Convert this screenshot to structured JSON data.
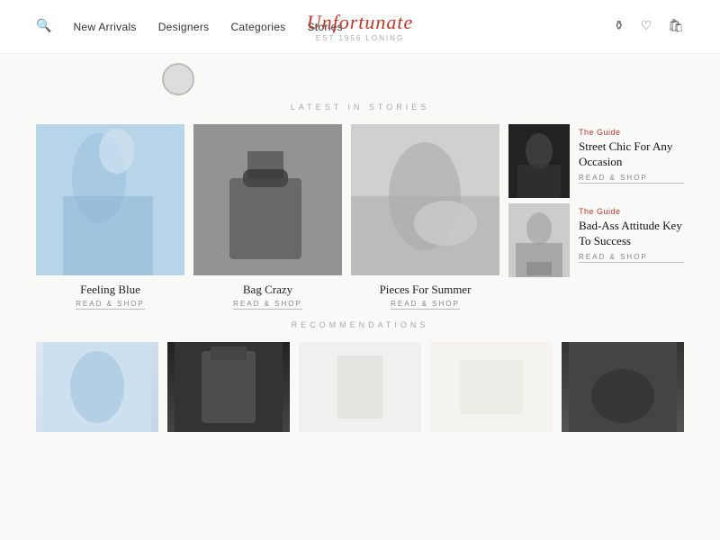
{
  "nav": {
    "links": [
      "New Arrivals",
      "Designers",
      "Categories",
      "Stories"
    ],
    "brand": "Unfortunate",
    "brand_sub": "EST 1956 LONING",
    "search_label": "🔍",
    "wishlist_label": "♡",
    "cart_label": "🛍"
  },
  "stories_section": {
    "label": "LATEST IN STORIES",
    "stories": [
      {
        "title": "Feeling Blue",
        "link": "READ & SHOP",
        "img_class": "story-img-blue"
      },
      {
        "title": "Bag Crazy",
        "link": "READ & SHOP",
        "img_class": "story-img-bw1"
      },
      {
        "title": "Pieces For Summer",
        "link": "READ & SHOP",
        "img_class": "story-img-bw2"
      }
    ],
    "side_articles": [
      {
        "guide": "The Guide",
        "title": "Street Chic For Any Occasion",
        "link": "READ & SHOP",
        "img_class": "side-article-img-1"
      },
      {
        "guide": "The Guide",
        "title": "Bad-Ass Attitude Key To Success",
        "link": "READ & SHOP",
        "img_class": "side-article-img-2"
      }
    ]
  },
  "recommendations_section": {
    "label": "RECOMMENDATIONS"
  }
}
